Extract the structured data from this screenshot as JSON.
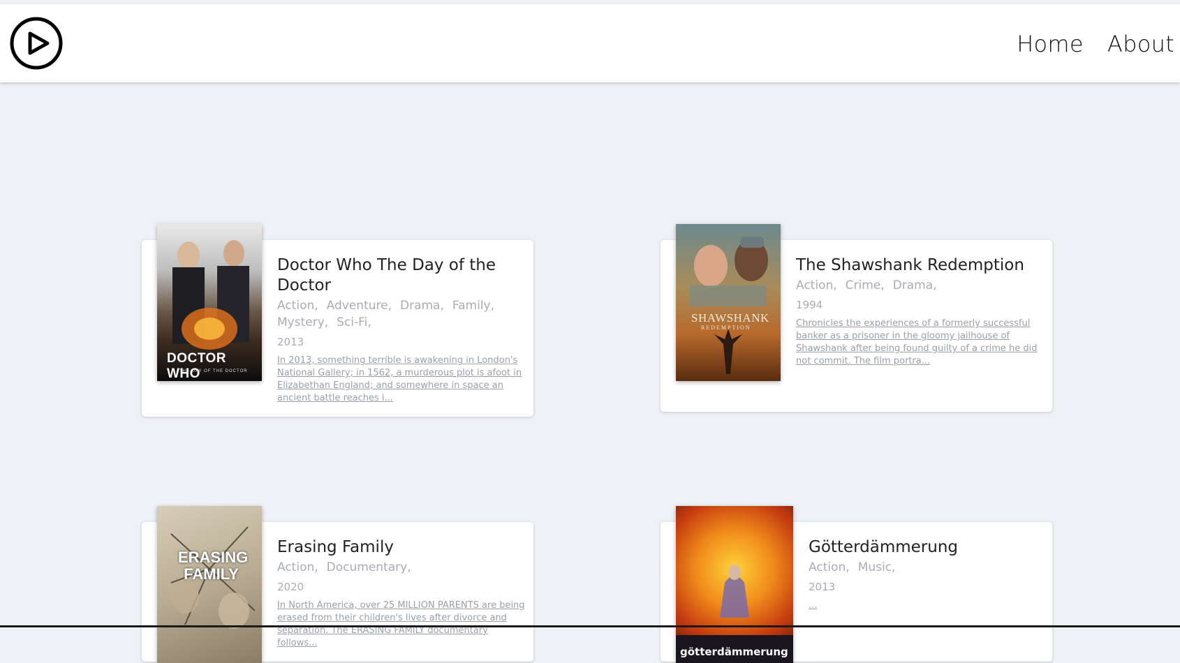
{
  "nav": {
    "home": "Home",
    "about": "About",
    "logo_icon": "play-circle-icon"
  },
  "movies": [
    {
      "title": "Doctor Who The Day of the Doctor",
      "genres": [
        "Action,",
        "Adventure,",
        "Drama,",
        "Family,",
        "Mystery,",
        "Sci-Fi,"
      ],
      "year": "2013",
      "summary": "In 2013, something terrible is awakening in London's National Gallery; in 1562, a murderous plot is afoot in Elizabethan England; and somewhere in space an ancient battle reaches i...",
      "poster_text": "DOCTOR WHO",
      "poster_subtext": "THE DAY OF THE DOCTOR"
    },
    {
      "title": "The Shawshank Redemption",
      "genres": [
        "Action,",
        "Crime,",
        "Drama,"
      ],
      "year": "1994",
      "summary": "Chronicles the experiences of a formerly successful banker as a prisoner in the gloomy jailhouse of Shawshank after being found guilty of a crime he did not commit. The film portra...",
      "poster_text": "SHAWSHANK",
      "poster_subtext": "REDEMPTION"
    },
    {
      "title": "Erasing Family",
      "genres": [
        "Action,",
        "Documentary,"
      ],
      "year": "2020",
      "summary": "In North America, over 25 MILLION PARENTS are being erased from their children's lives after divorce and separation. The ERASING FAMILY documentary follows...",
      "poster_text": "ERASING FAMILY"
    },
    {
      "title": "Götterdämmerung",
      "genres": [
        "Action,",
        "Music,"
      ],
      "year": "2013",
      "summary": "...",
      "poster_text": "götterdämmerung"
    }
  ]
}
